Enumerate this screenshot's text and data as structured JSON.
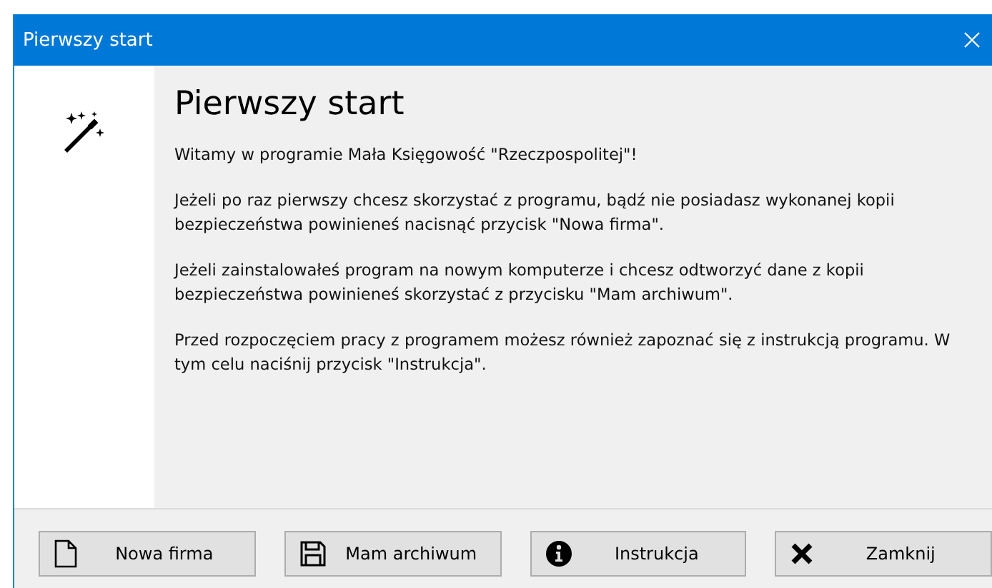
{
  "window": {
    "title": "Pierwszy start"
  },
  "heading": "Pierwszy start",
  "paragraphs": [
    "Witamy w programie Mała Księgowość \"Rzeczpospolitej\"!",
    "Jeżeli po raz pierwszy chcesz skorzystać z programu, bądź nie posiadasz wykonanej kopii bezpieczeństwa powinieneś nacisnąć przycisk \"Nowa firma\".",
    "Jeżeli zainstalowałeś program na nowym komputerze i chcesz odtworzyć dane z kopii bezpieczeństwa powinieneś skorzystać z przycisku \"Mam archiwum\".",
    "Przed rozpoczęciem pracy z programem możesz również zapoznać się z instrukcją programu. W tym celu naciśnij przycisk \"Instrukcja\"."
  ],
  "buttons": [
    {
      "label": "Nowa firma",
      "kind": "new"
    },
    {
      "label": "Mam archiwum",
      "kind": "save"
    },
    {
      "label": "Instrukcja",
      "kind": "info"
    },
    {
      "label": "Zamknij",
      "kind": "close"
    }
  ]
}
